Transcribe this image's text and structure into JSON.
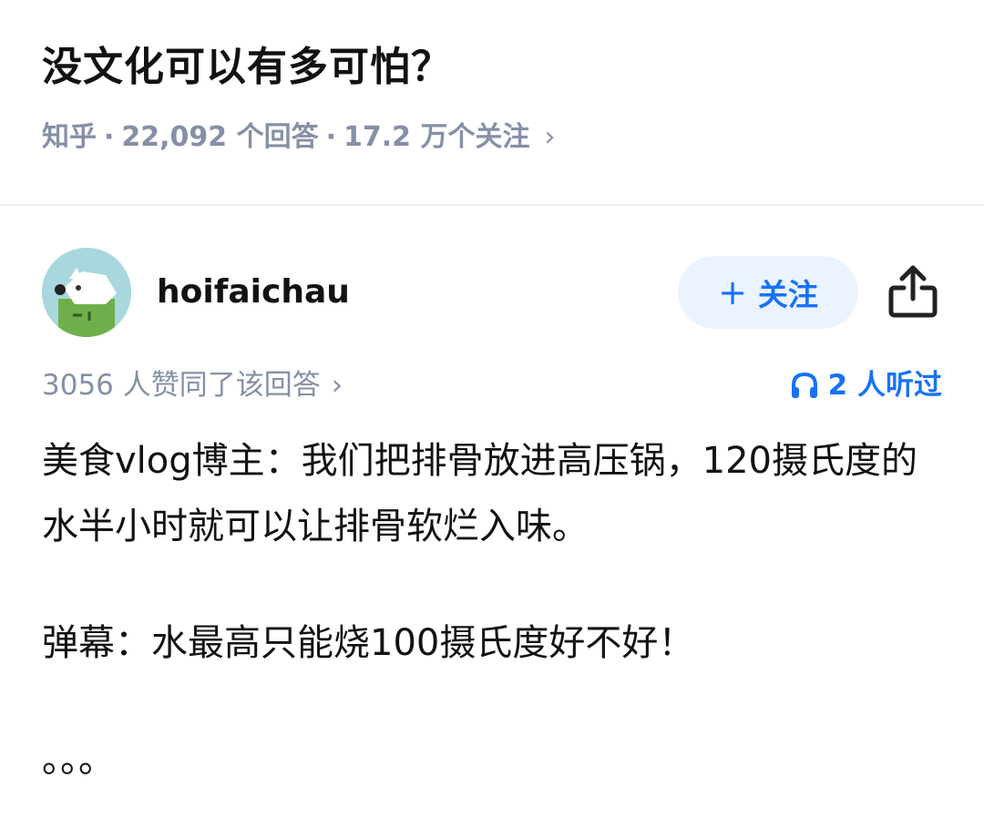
{
  "question": {
    "title": "没文化可以有多可怕？",
    "source": "知乎",
    "answers": "22,092 个回答",
    "followers": "17.2 万个关注"
  },
  "author": {
    "name": "hoifaichau",
    "follow_label": "关注"
  },
  "answer_meta": {
    "votes": "3056 人赞同了该回答",
    "listened": "2 人听过"
  },
  "content": {
    "paragraph1": "美食vlog博主：我们把排骨放进高压锅，120摄氏度的水半小时就可以让排骨软烂入味。",
    "paragraph2": "弹幕：水最高只能烧100摄氏度好不好！",
    "paragraph3": "。。。"
  },
  "colors": {
    "accent": "#1772f6",
    "meta_gray": "#8590a6",
    "follow_bg": "#ebf3ff",
    "avatar_bg": "#9fd0d8"
  }
}
